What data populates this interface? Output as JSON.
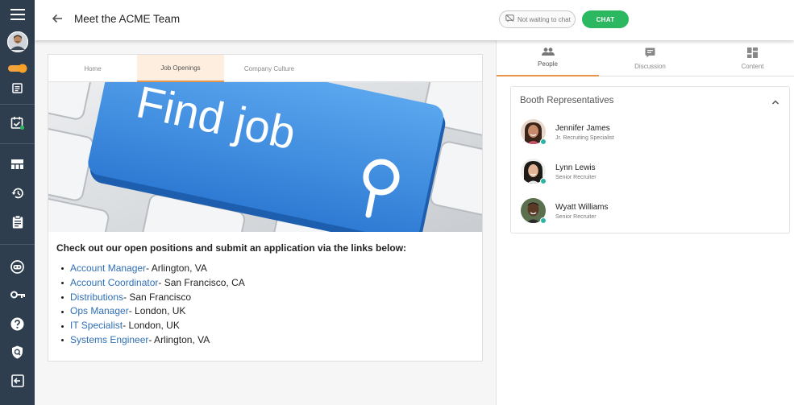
{
  "header": {
    "title": "Meet the ACME Team",
    "waiting_label": "Not waiting to chat",
    "chat_label": "CHAT"
  },
  "card": {
    "tabs": [
      {
        "label": "Home"
      },
      {
        "label": "Job Openings"
      },
      {
        "label": "Company Culture"
      }
    ],
    "active_tab": "Job Openings",
    "banner_text": "Find job",
    "intro": "Check out our open positions and submit an application via the links below:",
    "jobs": [
      {
        "title": "Account Manager",
        "location": " - Arlington, VA"
      },
      {
        "title": "Account Coordinator",
        "location": " - San Francisco, CA"
      },
      {
        "title": "Distributions",
        "location": " - San Francisco"
      },
      {
        "title": "Ops Manager",
        "location": " - London, UK"
      },
      {
        "title": "IT Specialist",
        "location": " - London, UK"
      },
      {
        "title": "Systems Engineer",
        "location": " - Arlington, VA"
      }
    ]
  },
  "right": {
    "tabs": [
      {
        "label": "People",
        "icon": "people-icon"
      },
      {
        "label": "Discussion",
        "icon": "discussion-icon"
      },
      {
        "label": "Content",
        "icon": "content-icon"
      }
    ],
    "active_tab": "People",
    "booth": {
      "title": "Booth Representatives",
      "reps": [
        {
          "name": "Jennifer James",
          "role": "Jr. Recruiting Specialist",
          "status": "online"
        },
        {
          "name": "Lynn Lewis",
          "role": "Senior Recruiter",
          "status": "online"
        },
        {
          "name": "Wyatt Williams",
          "role": "Senior Recruiter",
          "status": "online"
        }
      ]
    }
  },
  "sidebar": {
    "icons": [
      "menu-icon",
      "user-avatar",
      "toggle-icon",
      "agenda-icon",
      "calendar-check-icon",
      "dashboard-icon",
      "history-icon",
      "clipboard-icon",
      "bot-icon",
      "key-icon",
      "help-icon",
      "shield-icon",
      "logout-icon"
    ]
  },
  "colors": {
    "sidebar": "#2f3e4e",
    "accent": "#e8954c",
    "chat_button": "#2cb860",
    "link": "#2f6fb6",
    "online": "#2ab5a5",
    "banner_key": "#3f8de0"
  }
}
